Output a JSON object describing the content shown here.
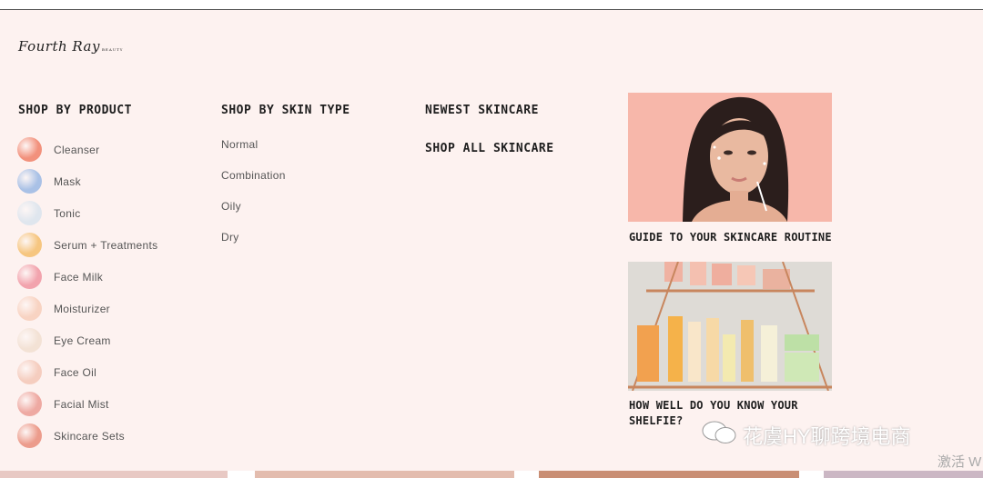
{
  "brand": {
    "logo_text": "Fourth Ray",
    "logo_sub": "BEAUTY"
  },
  "columns": {
    "product": {
      "title": "SHOP BY PRODUCT",
      "items": [
        {
          "label": "Cleanser",
          "color": "#f2917c"
        },
        {
          "label": "Mask",
          "color": "#a9c1e6"
        },
        {
          "label": "Tonic",
          "color": "#dfe6ee"
        },
        {
          "label": "Serum + Treatments",
          "color": "#f6c680"
        },
        {
          "label": "Face Milk",
          "color": "#f2a3ad"
        },
        {
          "label": "Moisturizer",
          "color": "#f8d3c2"
        },
        {
          "label": "Eye Cream",
          "color": "#f3e2d5"
        },
        {
          "label": "Face Oil",
          "color": "#f5cdbf"
        },
        {
          "label": "Facial Mist",
          "color": "#eea9a2"
        },
        {
          "label": "Skincare Sets",
          "color": "#ec9c8c"
        }
      ]
    },
    "skin_type": {
      "title": "SHOP BY SKIN TYPE",
      "items": [
        "Normal",
        "Combination",
        "Oily",
        "Dry"
      ]
    },
    "links": {
      "newest": "NEWEST SKINCARE",
      "all": "SHOP ALL SKINCARE"
    }
  },
  "promos": [
    {
      "caption": "GUIDE TO YOUR SKINCARE ROUTINE"
    },
    {
      "caption_line1": "HOW WELL DO YOU KNOW YOUR",
      "caption_line2": "SHELFIE?"
    }
  ],
  "overlay": {
    "watermark": "花虞HY聊跨境电商",
    "activate": "激活 W"
  },
  "colors": {
    "background": "#fdf2f0",
    "promo1_bg": "#f7b7aa",
    "accent": "#1e1e1e"
  }
}
